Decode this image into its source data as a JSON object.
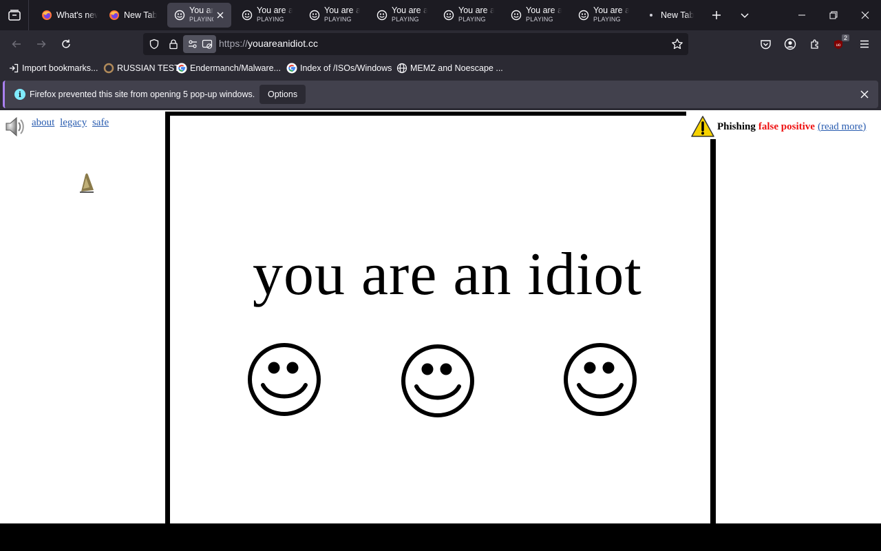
{
  "tabs": [
    {
      "title": "What's new",
      "status": "",
      "icon": "firefox-icon",
      "active": false
    },
    {
      "title": "New Tab",
      "status": "",
      "icon": "firefox-icon",
      "active": false
    },
    {
      "title": "You are an idiot",
      "status": "PLAYING",
      "icon": "smiley-icon",
      "active": true
    },
    {
      "title": "You are an idiot",
      "status": "PLAYING",
      "icon": "smiley-icon",
      "active": false
    },
    {
      "title": "You are an idiot",
      "status": "PLAYING",
      "icon": "smiley-icon",
      "active": false
    },
    {
      "title": "You are an idiot",
      "status": "PLAYING",
      "icon": "smiley-icon",
      "active": false
    },
    {
      "title": "You are an idiot",
      "status": "PLAYING",
      "icon": "smiley-icon",
      "active": false
    },
    {
      "title": "You are an idiot",
      "status": "PLAYING",
      "icon": "smiley-icon",
      "active": false
    },
    {
      "title": "You are an idiot",
      "status": "PLAYING",
      "icon": "smiley-icon",
      "active": false
    },
    {
      "title": "New Tab",
      "status": "",
      "icon": "dot-icon",
      "active": false
    }
  ],
  "urlbar": {
    "protocol": "https://",
    "host": "youareanidiot.cc"
  },
  "extensions": {
    "ublock_badge": "2"
  },
  "bookmarks": [
    {
      "label": "Import bookmarks...",
      "icon": "import-icon"
    },
    {
      "label": "RUSSIAN TEST",
      "icon": "site-icon"
    },
    {
      "label": "Endermanch/Malware...",
      "icon": "google-icon"
    },
    {
      "label": "Index of /ISOs/Windows",
      "icon": "google-icon"
    },
    {
      "label": "MEMZ and Noescape ...",
      "icon": "globe-icon"
    }
  ],
  "notification": {
    "message": "Firefox prevented this site from opening 5 pop-up windows.",
    "button": "Options"
  },
  "page": {
    "links": [
      "about",
      "legacy",
      "safe"
    ],
    "headline": "you are an idiot",
    "phishing": {
      "label": "Phishing",
      "status": "false positive",
      "link": "(read more)"
    }
  },
  "colors": {
    "tabstrip": "#1c1b22",
    "toolbar": "#2b2a33",
    "active_tab": "#42414d",
    "warning_red": "#e11111",
    "link_blue": "#2a5db0"
  }
}
